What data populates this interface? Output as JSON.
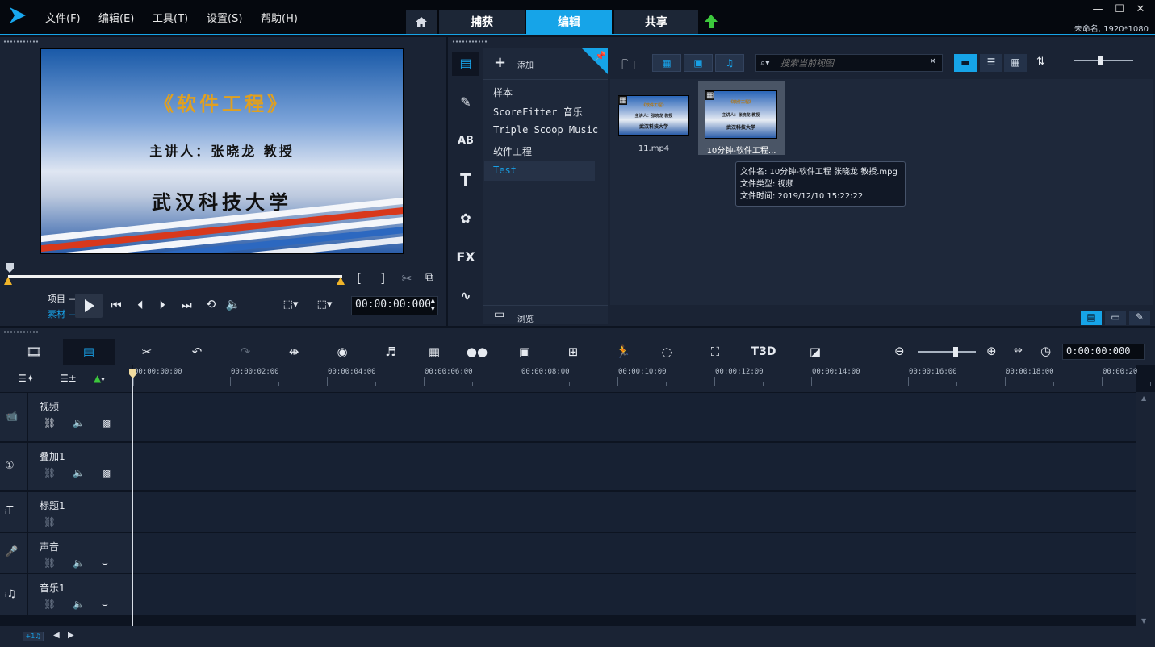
{
  "menu": {
    "file": "文件(F)",
    "edit": "编辑(E)",
    "tools": "工具(T)",
    "settings": "设置(S)",
    "help": "帮助(H)"
  },
  "steps": {
    "capture": "捕获",
    "edit": "编辑",
    "share": "共享"
  },
  "project_info": "未命名, 1920*1080",
  "player": {
    "title_line": "《软件工程》",
    "speaker_line": "主讲人：张晓龙 教授",
    "school_line": "武汉科技大学",
    "mode_project": "项目",
    "mode_clip": "素材",
    "timecode": "00:00:00:000"
  },
  "library": {
    "add_label": "添加",
    "browse_label": "浏览",
    "fx_label": "FX",
    "folders": [
      "样本",
      "ScoreFitter 音乐",
      "Triple Scoop Music",
      "软件工程",
      "Test"
    ],
    "search_placeholder": "搜索当前视图",
    "items": [
      {
        "name": "11.mp4",
        "line1": "《软件工程》",
        "line2": "主讲人：张晓龙 教授",
        "line3": "武汉科技大学"
      },
      {
        "name": "10分钟-软件工程...",
        "line1": "《软件工程》",
        "line2": "主讲人：张晓龙 教授",
        "line3": "武汉科技大学"
      }
    ],
    "tooltip": {
      "filename": "文件名: 10分钟-软件工程 张晓龙 教授.mpg",
      "filetype": "文件类型: 视频",
      "filetime": "文件时间: 2019/12/10 15:22:22"
    }
  },
  "timeline": {
    "timecode": "0:00:00:000",
    "ruler": [
      "00:00:00:00",
      "00:00:02:00",
      "00:00:04:00",
      "00:00:06:00",
      "00:00:08:00",
      "00:00:10:00",
      "00:00:12:00",
      "00:00:14:00",
      "00:00:16:00",
      "00:00:18:00",
      "00:00:20"
    ],
    "tracks": [
      {
        "name": "视频"
      },
      {
        "name": "叠加1"
      },
      {
        "name": "标题1"
      },
      {
        "name": "声音"
      },
      {
        "name": "音乐1"
      }
    ],
    "title_tool_label": "T3D",
    "add_track_label": "+1♫"
  },
  "colors": {
    "accent": "#16a4e8",
    "bg": "#0d1421",
    "panel": "#1a2334"
  }
}
